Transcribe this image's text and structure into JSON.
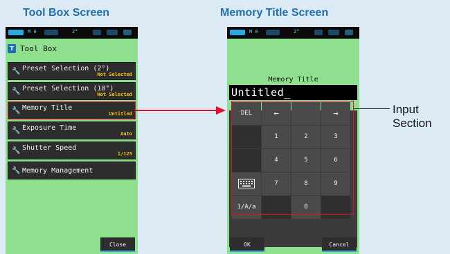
{
  "captions": {
    "left": "Tool Box Screen",
    "right": "Memory Title Screen"
  },
  "status_bar": {
    "mode": "M 0",
    "angle": "2°"
  },
  "toolbox": {
    "icon_glyph": "T",
    "title": "Tool Box",
    "items": [
      {
        "label": "Preset Selection (2°)",
        "value": "Not Selected"
      },
      {
        "label": "Preset Selection (10°)",
        "value": "Not Selected"
      },
      {
        "label": "Memory Title",
        "value": "Untitled"
      },
      {
        "label": "Exposure Time",
        "value": "Auto"
      },
      {
        "label": "Shutter Speed",
        "value": "1/125"
      },
      {
        "label": "Memory Management",
        "value": ""
      }
    ],
    "close_label": "Close"
  },
  "memory_title": {
    "title": "Memory Title",
    "entry_text": "Untitled_",
    "keys": {
      "del": "DEL",
      "left": "←",
      "right": "→",
      "k1": "1",
      "k2": "2",
      "k3": "3",
      "k4": "4",
      "k5": "5",
      "k6": "6",
      "k7": "7",
      "k8": "8",
      "k9": "9",
      "k0": "0",
      "mode": "1/A/a"
    },
    "ok_label": "OK",
    "cancel_label": "Cancel"
  },
  "annotation": {
    "line1": "Input",
    "line2": "Section"
  },
  "colors": {
    "caption": "#1f6fb2",
    "highlight": "#e0102a",
    "screen_bg": "#8ee08e",
    "value_text": "#f5c400"
  },
  "icons": {
    "menu_item": "wrench-icon",
    "header": "toolbox-icon",
    "keyboard": "keyboard-icon"
  }
}
